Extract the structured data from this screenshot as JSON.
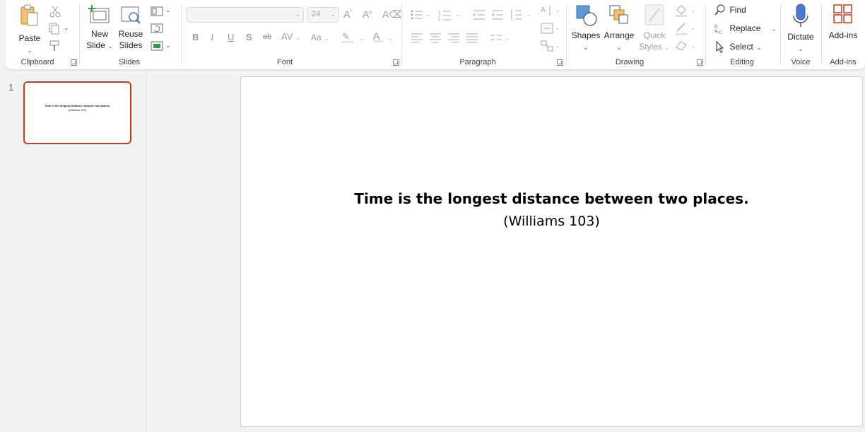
{
  "ribbon": {
    "clipboard": {
      "label": "Clipboard",
      "paste": "Paste"
    },
    "slides": {
      "label": "Slides",
      "new_slide_1": "New",
      "new_slide_2": "Slide",
      "reuse_1": "Reuse",
      "reuse_2": "Slides"
    },
    "font": {
      "label": "Font",
      "font_name": "",
      "font_size": "24"
    },
    "paragraph": {
      "label": "Paragraph"
    },
    "drawing": {
      "label": "Drawing",
      "shapes": "Shapes",
      "arrange": "Arrange",
      "quick_styles_1": "Quick",
      "quick_styles_2": "Styles"
    },
    "editing": {
      "label": "Editing",
      "find": "Find",
      "replace": "Replace",
      "select": "Select"
    },
    "voice": {
      "label": "Voice",
      "dictate": "Dictate"
    },
    "addins": {
      "label": "Add-ins",
      "addins": "Add-ins"
    }
  },
  "thumbnails": [
    {
      "number": "1",
      "title": "Time is the longest distance between two places.",
      "subtitle": "(Williams 103)"
    }
  ],
  "slide": {
    "title": "Time is the longest distance between two places.",
    "subtitle": "(Williams 103)"
  },
  "colors": {
    "accent": "#c43e1c",
    "shapes_blue": "#5b9bd5",
    "dictate_blue": "#4a7bd0",
    "addins_red": "#c43e1c"
  }
}
